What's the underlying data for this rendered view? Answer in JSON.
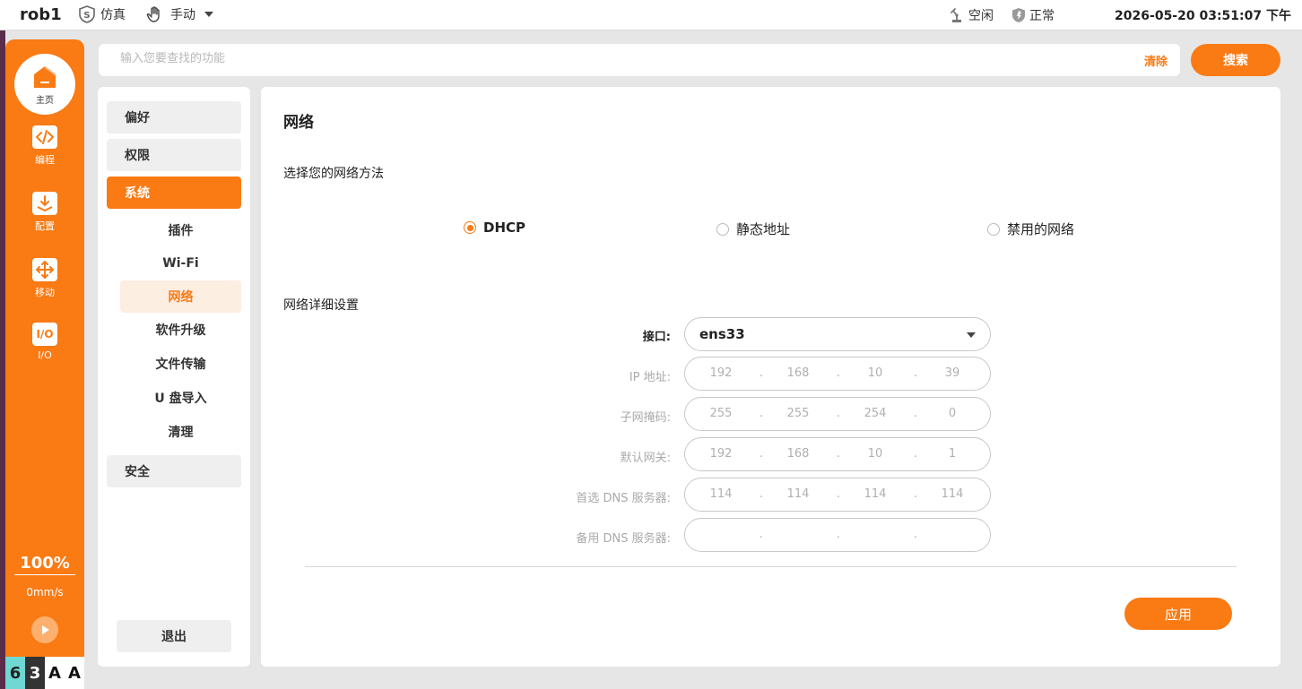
{
  "topbar": {
    "robot_name": "rob1",
    "sim_label": "仿真",
    "manual_label": "手动",
    "status_idle": "空闲",
    "status_normal": "正常",
    "datetime": "2026-05-20 03:51:07 下午"
  },
  "rail": {
    "home": "主页",
    "items": [
      {
        "label": "编程",
        "icon": "code-icon"
      },
      {
        "label": "配置",
        "icon": "download-icon"
      },
      {
        "label": "移动",
        "icon": "move-icon"
      },
      {
        "label": "I/O",
        "icon": "io-icon"
      }
    ],
    "speed_percent": "100%",
    "speed_value": "0mm/s",
    "bottom_tiles": [
      "6",
      "3",
      "A",
      "A"
    ]
  },
  "search": {
    "placeholder": "输入您要查找的功能",
    "clear_label": "清除",
    "button_label": "搜索"
  },
  "menu": {
    "groups": [
      "偏好",
      "权限",
      "系统",
      "安全"
    ],
    "active_group": "系统",
    "sub_items": [
      "插件",
      "Wi-Fi",
      "网络",
      "软件升级",
      "文件传输",
      "U 盘导入",
      "清理"
    ],
    "active_sub": "网络",
    "logout": "退出"
  },
  "content": {
    "title": "网络",
    "method_label": "选择您的网络方法",
    "methods": [
      "DHCP",
      "静态地址",
      "禁用的网络"
    ],
    "selected_method": "DHCP",
    "detail_label": "网络详细设置",
    "interface_label": "接口:",
    "interface_value": "ens33",
    "fields": [
      {
        "label": "IP 地址:",
        "parts": [
          "192",
          "168",
          "10",
          "39"
        ]
      },
      {
        "label": "子网掩码:",
        "parts": [
          "255",
          "255",
          "254",
          "0"
        ]
      },
      {
        "label": "默认网关:",
        "parts": [
          "192",
          "168",
          "10",
          "1"
        ]
      },
      {
        "label": "首选 DNS 服务器:",
        "parts": [
          "114",
          "114",
          "114",
          "114"
        ]
      },
      {
        "label": "备用 DNS 服务器:",
        "parts": [
          "",
          "",
          "",
          ""
        ]
      }
    ],
    "apply_label": "应用"
  },
  "colors": {
    "accent": "#fa7a14",
    "accent_light": "#fdeee2",
    "background": "#e6e6e6"
  }
}
